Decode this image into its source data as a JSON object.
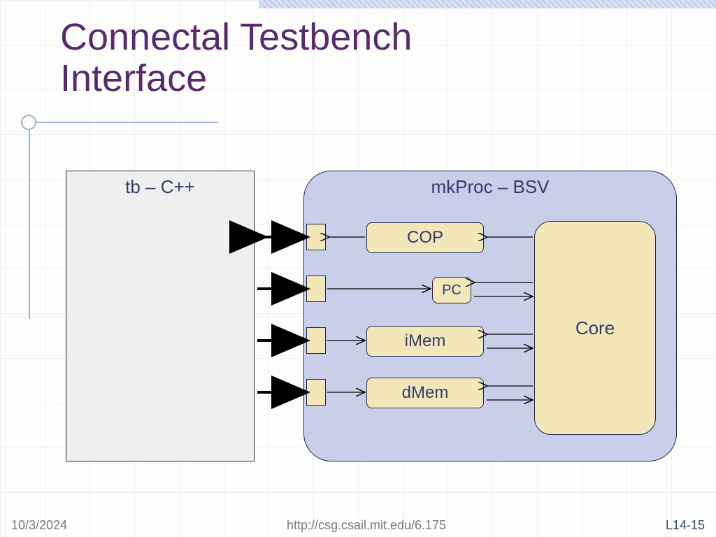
{
  "title_line1": "Connectal Testbench",
  "title_line2": "Interface",
  "tb": {
    "label": "tb – C++"
  },
  "mkproc": {
    "label": "mkProc – BSV"
  },
  "blocks": {
    "cop": "COP",
    "pc": "PC",
    "imem": "iMem",
    "dmem": "dMem",
    "core": "Core"
  },
  "footer": {
    "date": "10/3/2024",
    "url": "http://csg.csail.mit.edu/6.175",
    "slide": "L14-15"
  },
  "colors": {
    "title": "#5a2a6e",
    "box_fill": "#f3e7b9",
    "mkproc_fill": "#c9cfe8",
    "stroke": "#1a2a55"
  }
}
